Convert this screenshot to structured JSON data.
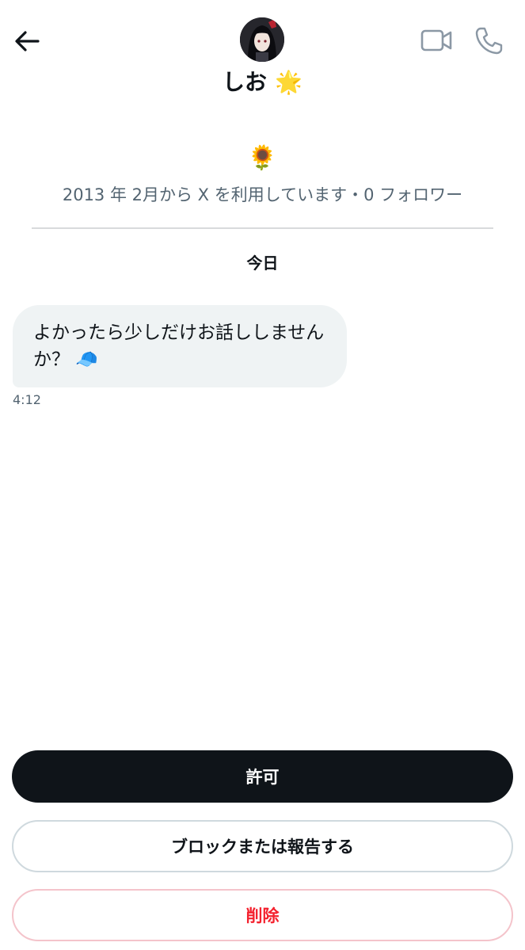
{
  "header": {
    "user_name": "しお",
    "name_emoji": "🌟"
  },
  "profile": {
    "bio_emoji": "🌻",
    "meta": "2013 年 2月から X を利用しています・0 フォロワー"
  },
  "conversation": {
    "date_label": "今日",
    "messages": [
      {
        "text": "よかったら少しだけお話ししませんか？ 🧢",
        "time": "4:12"
      }
    ]
  },
  "actions": {
    "allow_label": "許可",
    "block_label": "ブロックまたは報告する",
    "delete_label": "削除"
  },
  "colors": {
    "primary_text": "#0f1419",
    "secondary_text": "#536471",
    "bubble_bg": "#eff3f4",
    "danger": "#f4212e"
  },
  "icons": {
    "back": "arrow-left-icon",
    "video": "video-camera-icon",
    "phone": "phone-icon"
  }
}
